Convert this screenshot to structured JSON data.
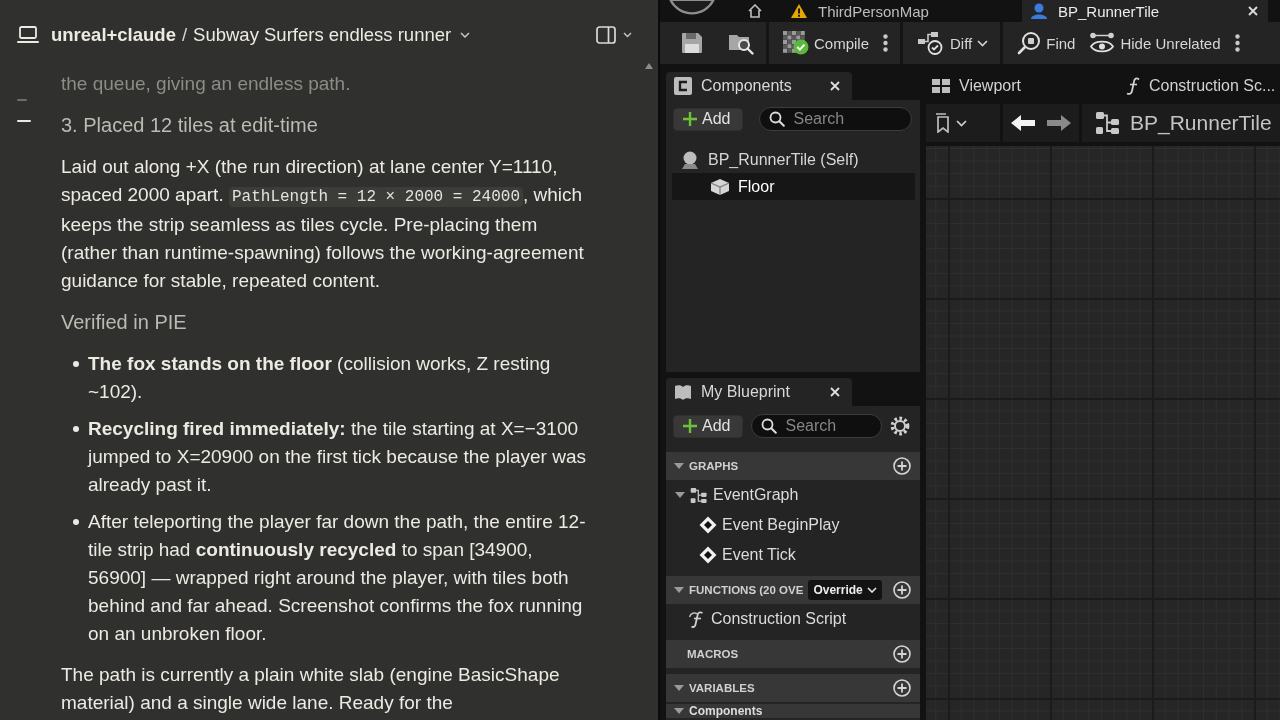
{
  "chat": {
    "project": "unreal+claude",
    "separator": "/",
    "title": "Subway Surfers endless runner",
    "outline_markers": [
      {
        "selected": false
      },
      {
        "selected": true
      }
    ],
    "blocks": [
      {
        "kind": "paragraph",
        "faded": true,
        "parts": [
          {
            "kind": "text",
            "text": "the queue, giving an endless path."
          }
        ]
      },
      {
        "kind": "heading",
        "text": "3. Placed 12 tiles at edit-time"
      },
      {
        "kind": "paragraph",
        "faded": false,
        "parts": [
          {
            "kind": "text",
            "text": "Laid out along +X (the run direction) at lane center Y=1110, spaced 2000 apart. "
          },
          {
            "kind": "code",
            "text": "PathLength = 12 × 2000 = 24000"
          },
          {
            "kind": "text",
            "text": ", which keeps the strip seamless as tiles cycle. Pre-placing them (rather than runtime-spawning) follows the working-agreement guidance for stable, repeated content."
          }
        ]
      },
      {
        "kind": "heading",
        "text": "Verified in PIE"
      },
      {
        "kind": "list",
        "items": [
          "**The fox stands on the floor** (collision works, Z resting ~102).",
          "**Recycling fired immediately:** the tile starting at X=−3100 jumped to X=20900 on the first tick because the player was already past it.",
          "After teleporting the player far down the path, the entire 12-tile strip had **continuously recycled** to span [34900, 56900] — wrapped right around the player, with tiles both behind and far ahead. Screenshot confirms the fox running on an unbroken floor."
        ]
      },
      {
        "kind": "paragraph",
        "faded": false,
        "parts": [
          {
            "kind": "text",
            "text": "The path is currently a plain white slab (engine BasicShape material) and a single wide lane. Ready for the"
          }
        ]
      }
    ]
  },
  "editor": {
    "doc_tabs": [
      {
        "kind": "level",
        "label": "ThirdPersonMap",
        "selected": false
      },
      {
        "kind": "blueprint",
        "label": "BP_RunnerTile",
        "selected": true
      }
    ],
    "toolbar": [
      [
        {
          "kind": "save",
          "more": false,
          "dropdown": false
        },
        {
          "kind": "browse",
          "more": false,
          "dropdown": false
        }
      ],
      [
        {
          "kind": "compile",
          "label": "Compile",
          "more": true,
          "dropdown": false
        }
      ],
      [
        {
          "kind": "diff",
          "label": "Diff",
          "more": false,
          "dropdown": true
        }
      ],
      [
        {
          "kind": "find",
          "label": "Find",
          "more": false,
          "dropdown": false
        },
        {
          "kind": "hide_unrelated",
          "label": "Hide Unrelated",
          "more": true,
          "dropdown": false
        }
      ]
    ],
    "components": {
      "title": "Components",
      "add": "Add",
      "search": {
        "placeholder": "Search"
      },
      "tree": [
        {
          "kind": "actor",
          "label": "BP_RunnerTile (Self)",
          "selected": false,
          "children": [
            {
              "kind": "mesh",
              "label": "Floor",
              "selected": true
            }
          ]
        }
      ]
    },
    "graph_tabs": [
      {
        "kind": "viewport",
        "label": "Viewport"
      },
      {
        "kind": "function",
        "label": "Construction Sc..."
      }
    ],
    "nav": {
      "back_disabled": false,
      "forward_disabled": true,
      "title": "BP_RunnerTile"
    },
    "my_blueprint": {
      "title": "My Blueprint",
      "add": "Add",
      "search": {
        "placeholder": "Search"
      },
      "sections": [
        {
          "kind": "collapsible",
          "title": "GRAPHS",
          "expanded": true,
          "items": [
            {
              "kind": "graph",
              "label": "EventGraph",
              "expanded": true,
              "children": [
                {
                  "kind": "event",
                  "label": "Event BeginPlay"
                },
                {
                  "kind": "event",
                  "label": "Event Tick"
                }
              ]
            }
          ]
        },
        {
          "kind": "collapsible",
          "title": "FUNCTIONS (20 OVE",
          "expanded": true,
          "override": "Override",
          "items": [
            {
              "kind": "function",
              "label": "Construction Script"
            }
          ]
        },
        {
          "kind": "plain",
          "title": "MACROS"
        },
        {
          "kind": "collapsible",
          "title": "VARIABLES",
          "expanded": true,
          "items": [
            {
              "kind": "category",
              "label": "Components",
              "expanded": true
            }
          ]
        }
      ]
    }
  }
}
